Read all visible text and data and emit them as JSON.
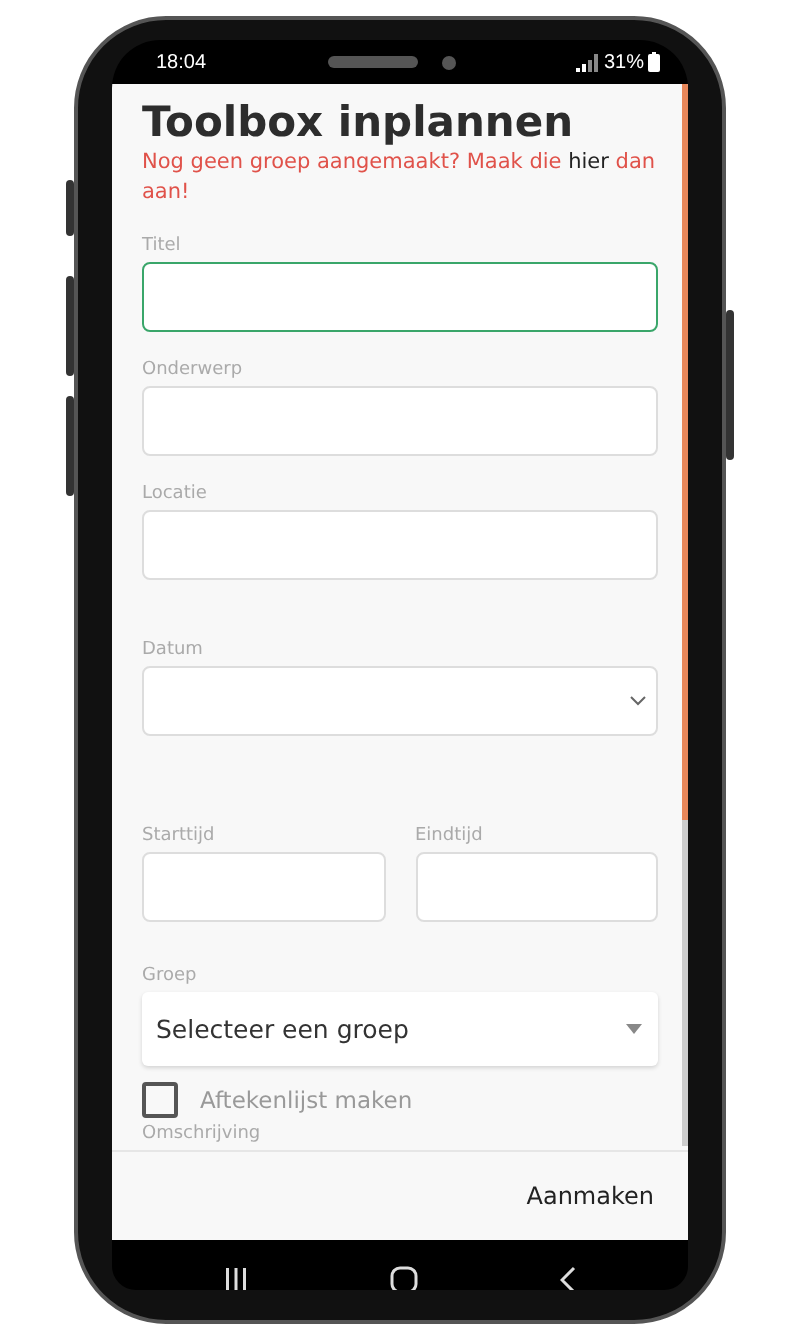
{
  "status_bar": {
    "time": "18:04",
    "battery": "31%"
  },
  "title": "Toolbox inplannen",
  "notice": {
    "text": "Nog geen groep aangemaakt? Maak die ",
    "link": "hier",
    "text_end": " dan aan!"
  },
  "fields": [
    {
      "kind": "text",
      "label": "Titel",
      "focused": true
    },
    {
      "kind": "text",
      "label": "Onderwerp",
      "focused": false
    },
    {
      "kind": "text",
      "label": "Locatie",
      "focused": false
    },
    {
      "kind": "date",
      "label": "Datum",
      "focused": false
    }
  ],
  "time_fields": [
    {
      "label": "Starttijd"
    },
    {
      "label": "Eindtijd"
    }
  ],
  "group_select": {
    "label": "Groep",
    "placeholder": "Selecteer een groep"
  },
  "checkbox": {
    "label": "Aftekenlijst maken",
    "checked": false
  },
  "description_label": "Omschrijving",
  "submit": "Aanmaken"
}
